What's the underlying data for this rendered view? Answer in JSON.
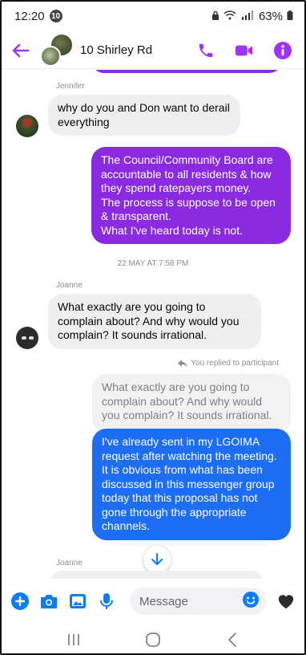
{
  "status_bar": {
    "time": "12:20",
    "notification_count": "10",
    "battery": "63%"
  },
  "header": {
    "title": "10 Shirley Rd",
    "accent_color": "#a033ff"
  },
  "messages": {
    "m1_sender": "Jennifer",
    "m1_text": "why do you and Don want to derail everything",
    "m2_text": "The Council/Community Board are accountable to all residents & how they spend ratepayers money.\nThe process is suppose to be open & transparent.\nWhat I've heard today is not.",
    "timestamp": "22 MAY AT 7:58 PM",
    "m3_sender": "Joanne",
    "m3_text": "What exactly are you going to complain about?  And why would you complain?  It sounds irrational.",
    "replied_label": "You replied to participant",
    "quoted_text": "What exactly are you going to complain about?  And why would you complain?  It sounds irrational.",
    "m4_text": "I've already sent in my LGOIMA request after watching the meeting.\nIt is obvious from what has been discussed in this messenger group today that this proposal has not gone through the appropriate channels.",
    "m5_sender": "Joanne"
  },
  "composer": {
    "placeholder": "Message"
  },
  "colors": {
    "purple_bubble": "#8a2be2",
    "blue_bubble": "#1e6ef5",
    "icon_blue": "#0a7cff"
  }
}
